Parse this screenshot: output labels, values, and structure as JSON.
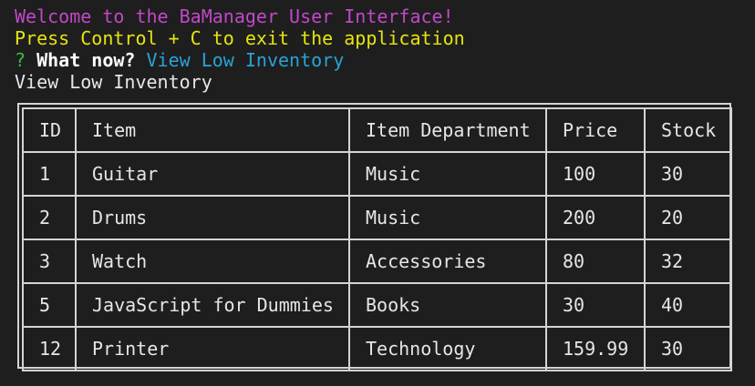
{
  "terminal": {
    "welcome": "Welcome to the BaManager User Interface!",
    "exit_hint": "Press Control + C to exit the application",
    "prompt_mark": "?",
    "prompt_question": "What now?",
    "prompt_answer": "View Low Inventory",
    "echo": "View Low Inventory"
  },
  "table": {
    "headers": [
      "ID",
      "Item",
      "Item Department",
      "Price",
      "Stock"
    ],
    "rows": [
      [
        "1",
        "Guitar",
        "Music",
        "100",
        "30"
      ],
      [
        "2",
        "Drums",
        "Music",
        "200",
        "20"
      ],
      [
        "3",
        "Watch",
        "Accessories",
        "80",
        "32"
      ],
      [
        "5",
        "JavaScript for Dummies",
        "Books",
        "30",
        "40"
      ],
      [
        "12",
        "Printer",
        "Technology",
        "159.99",
        "30"
      ]
    ]
  },
  "colors": {
    "background": "#1e1e1e",
    "welcome": "#c248c8",
    "exit_hint": "#e5e510",
    "prompt_mark": "#3fb93f",
    "prompt_answer": "#29a3d6",
    "border": "#d4d4d4"
  }
}
